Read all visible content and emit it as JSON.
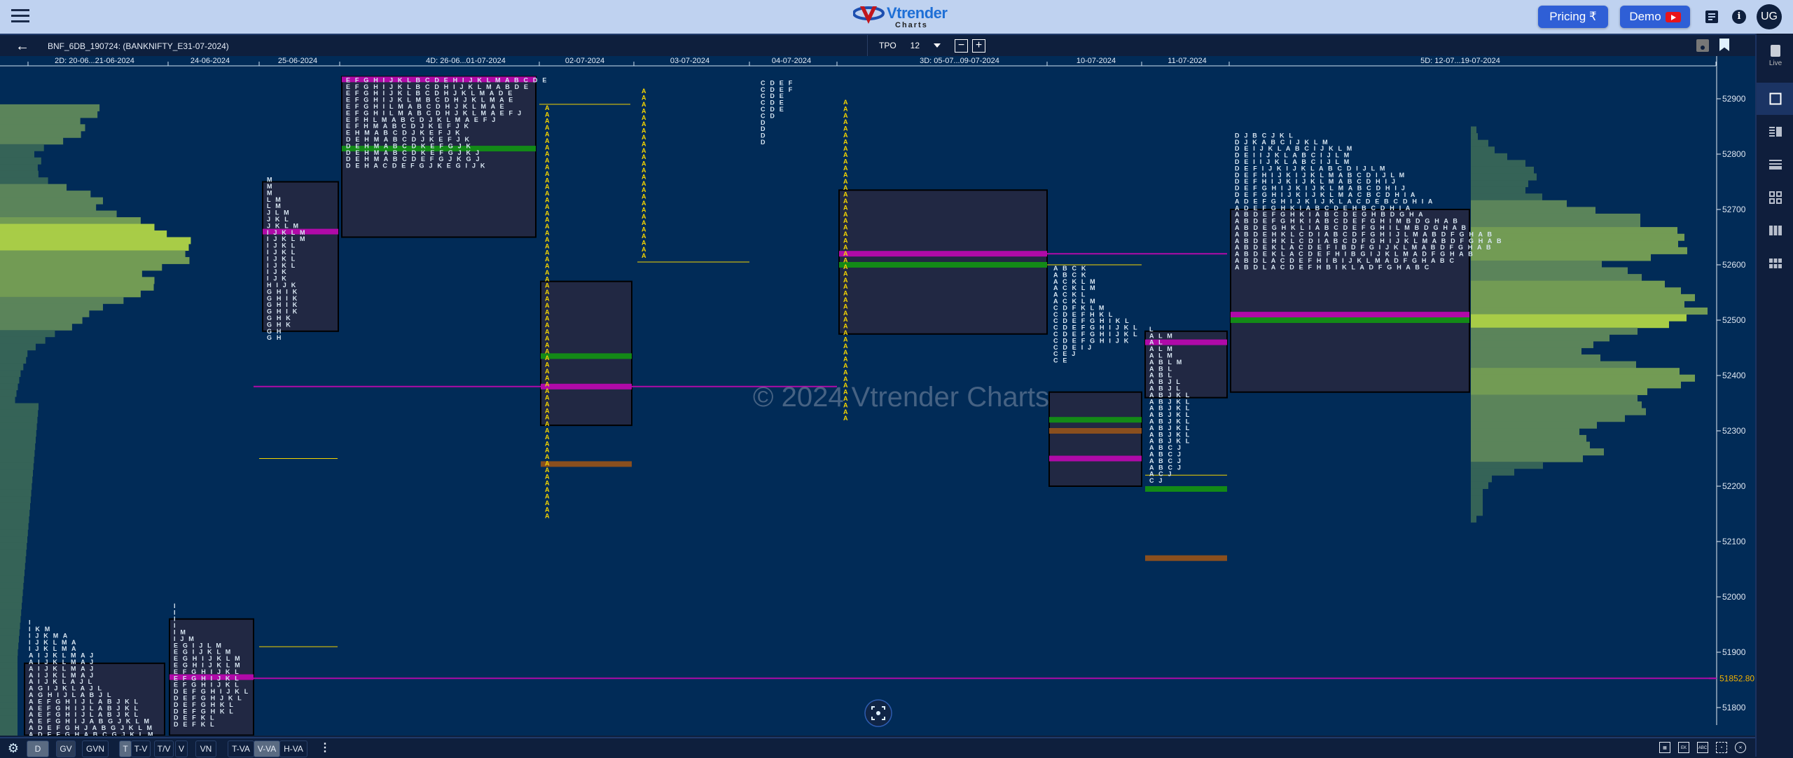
{
  "app": {
    "logo_text": "Vtrender",
    "logo_sub": "Charts",
    "pricing_label": "Pricing ₹",
    "demo_label": "Demo",
    "avatar_initials": "UG",
    "symbol_title": "BNF_6DB_190724: (BANKNIFTY_E31-07-2024)",
    "tpo_label": "TPO",
    "tpo_value": "12",
    "rail_live_label": "Live",
    "watermark": "© 2024 Vtrender Charts",
    "colors": {
      "accent": "#2f5fd6",
      "poc": "#b00aa8",
      "va_green": "#138a17",
      "brown": "#8a4f1e",
      "profile_bg": "#212843",
      "chart_bg": "#012b57",
      "vol_dark": "#356357",
      "vol_mid": "#5b845a",
      "vol_light": "#729b54",
      "vol_poc": "#a8cc47",
      "tpo_yellow": "#f5d400",
      "tpo_text": "#d8e6f2"
    }
  },
  "bottom_toolbar": {
    "buttons": [
      "D",
      "GV",
      "GVN",
      "T",
      "T-V",
      "T/V",
      "V",
      "VN",
      "T-VA",
      "V-VA",
      "H-VA"
    ],
    "selected": [
      "D",
      "T",
      "V-VA"
    ]
  },
  "chart_data": {
    "type": "market_profile",
    "title": "BNF_6DB_190724: (BANKNIFTY_E31-07-2024)",
    "y_axis": {
      "ticks": [
        52900,
        52800,
        52700,
        52600,
        52500,
        52400,
        52300,
        52200,
        52100,
        52000,
        51900,
        51800
      ],
      "range": [
        51750,
        52950
      ]
    },
    "current_price": 51852.8,
    "current_price_label": "51852.80",
    "sessions": [
      {
        "label": "2D: 20-06...21-06-2024",
        "high": 51960,
        "low": 51750,
        "va_high": 51880,
        "va_low": 51750,
        "poc": null,
        "rows_top": [
          "I",
          "I K M",
          "I J K M A",
          "I J K L M A",
          "I J K L M A",
          "A I J K L M A J",
          "A I J K L M A J",
          "A I J K L M A J",
          "A I J K L M A J",
          "A I J K L A J L",
          "A G I J K L A J L",
          "A G H I J L A B J L",
          "A E F G H I J L A B J K L",
          "A E F G H I J L A B J K L",
          "A E F G H I J L A B J K L",
          "A E F G H I J A B G J K L M",
          "A D E F G H J A B G J K L M",
          "A D E F G H A B C G J K L M"
        ]
      },
      {
        "label": "24-06-2024",
        "high": 51990,
        "low": 51750,
        "va_high": 51960,
        "va_low": 51750,
        "poc": 51855,
        "rows_top": [
          "I",
          "I",
          "I",
          "I",
          "I M",
          "I J M",
          "E G I J L M",
          "E G I J K L M",
          "E G H I J K L M",
          "E G H I J K L M",
          "E F G H I J K L",
          "E F G H I J K L",
          "E F G H I J K L",
          "D E F G H I J K L",
          "D E F G H J K L",
          "D E F G H K L",
          "D E F G H K L",
          "D E F K L",
          "D E F K L"
        ]
      },
      {
        "label": "25-06-2024",
        "high": 52760,
        "low": 51910,
        "va_high": 52750,
        "va_low": 52480,
        "poc": 52660,
        "rows_top": [
          "M",
          "M",
          "M",
          "L M",
          "L M",
          "J L M",
          "J K L",
          "J K L M",
          "I J K L M",
          "I J K L M",
          "I J K L",
          "I J K L",
          "I J K L",
          "I J K L",
          "I J K",
          "I J K",
          "H I J K",
          "G H I K",
          "G H I K",
          "G H I K",
          "G H I K",
          "G H K",
          "G H K",
          "G H",
          "G H"
        ]
      },
      {
        "label": "4D: 26-06...01-07-2024",
        "high": 52940,
        "low": 52300,
        "va_high": 52940,
        "va_low": 52650,
        "poc": 52935,
        "va_green": 52810,
        "rows_top": [
          "E F G H I J K L B C D E H I J K L M A B C D E",
          "E F G H I J K L B C D H I J K L M A B D E",
          "E F G H I J K L B C D H J K L M A D E",
          "E F G H I J K L M B C D H J K L M A E",
          "E F G H I L M A B C D H J K L M A E",
          "E F G H I L M A B C D H J K L M A E F J",
          "E F H L M A B C D J K L M A E F J",
          "E F H M A B C D J K E F J K",
          "E H M A B C D J K E F J K",
          "D E H M A B C D J K E F J K",
          "D E H M A B C D K E F G J K",
          "D E H M A B C D K E F G J K J",
          "D E H M A B C D E F G J K G J",
          "D E H A C D E F G J K E G I J K"
        ]
      },
      {
        "label": "02-07-2024",
        "high": 52890,
        "low": 52140,
        "va_high": 52570,
        "va_low": 52310,
        "poc": 52380,
        "va_green": 52435,
        "brown": 52240
      },
      {
        "label": "03-07-2024",
        "high": 52920,
        "low": 52605,
        "va_high": null,
        "va_low": null,
        "poc": null
      },
      {
        "label": "04-07-2024",
        "high": 52935,
        "low": 52840,
        "va_high": null,
        "va_low": null,
        "poc": null,
        "rows_top": [
          "C D E F",
          "C D E F",
          "C D E",
          "C D E",
          "C D E",
          "C D",
          "D",
          "D",
          "D",
          "D"
        ]
      },
      {
        "label": "3D: 05-07...09-07-2024",
        "high": 52900,
        "low": 52310,
        "va_high": 52735,
        "va_low": 52475,
        "poc": 52620,
        "va_green": 52600
      },
      {
        "label": "10-07-2024",
        "high": 52600,
        "low": 52200,
        "va_high": 52370,
        "va_low": 52200,
        "poc": 52250,
        "va_green": 52320,
        "brown": 52300,
        "rows_top": [
          "A B C K",
          "A B C K",
          "A C K L M",
          "A C K L M",
          "A C K L",
          "A C K L M",
          "C D F K L M",
          "C D E F H K L",
          "C D E F G H I K L",
          "C D E F G H I J K L",
          "C D E F G H I J K L",
          "C D E F G H I J K",
          "C D E I J",
          "C E J",
          "C E"
        ]
      },
      {
        "label": "11-07-2024",
        "high": 52490,
        "low": 51850,
        "va_high": 52480,
        "va_low": 52360,
        "poc": 52460,
        "va_green": 52195,
        "brown": 52070,
        "rows_top": [
          "L",
          "A L M",
          "A L",
          "A L M",
          "A L M",
          "A B L M",
          "A B L",
          "A B L",
          "A B J L",
          "A B J L",
          "A B J K L",
          "A B J K L",
          "A B J K L",
          "A B J K L",
          "A B J K L",
          "A B J K L",
          "A B J K L",
          "A B J K L",
          "A B C J",
          "A B C J",
          "A B C J",
          "A B C J",
          "A C J",
          "C J"
        ]
      },
      {
        "label": "5D: 12-07...19-07-2024",
        "high": 52840,
        "low": 52130,
        "va_high": 52700,
        "va_low": 52370,
        "poc": 52510,
        "va_green": 52500,
        "rows_top": [
          "D J B C J K L",
          "D J K A B C I J K L M",
          "D E I J K L A B C I J K L M",
          "D E I I J K L A B C I J L M",
          "D E I I J K L A B C I J L M",
          "D E F I J K I J K L A B C D I J L M",
          "D E F H I J K I J K L M A B C D I J L M",
          "D E F H I J K I J K L M A B C D H I J",
          "D E F G H I J K I J K L M A B C D H I J",
          "D E F G H I J K I J K L M A C B C D H I A",
          "A D E F G H I J K I J K L A C D E B C D H I A",
          "A D E F G H K I A B C D E H B C D H I A",
          "A B D E F G H K I A B C D E G H B D G H A",
          "A B D E F G H K I A B C D E F G H I M B D G H A B",
          "A B D E G H K L I A B C D E F G H I L M B D G H A B",
          "A B D E H K L C D I A B C D F G H I J L M A B D F G H A B",
          "A B D E H K L C D I A B C D F G H I J K L M A B D F G H A B",
          "A B D E K L A C D E F I B D F G I J K L M A B D F G H A B",
          "A B D E K L A C D E F H I B G I J K L M A D F G H A B",
          "A B D L A C D E F H I B I J K L M A D F G H A B C",
          "A B D L A C D E F H B I K L A D F G H A B C"
        ]
      }
    ],
    "composite_left_volume_profile": {
      "poc": 52655,
      "note": "multi-day composite volume profile on left edge"
    },
    "composite_right_volume_profile": {
      "poc": 52510,
      "high": 52850,
      "low": 52135
    }
  }
}
